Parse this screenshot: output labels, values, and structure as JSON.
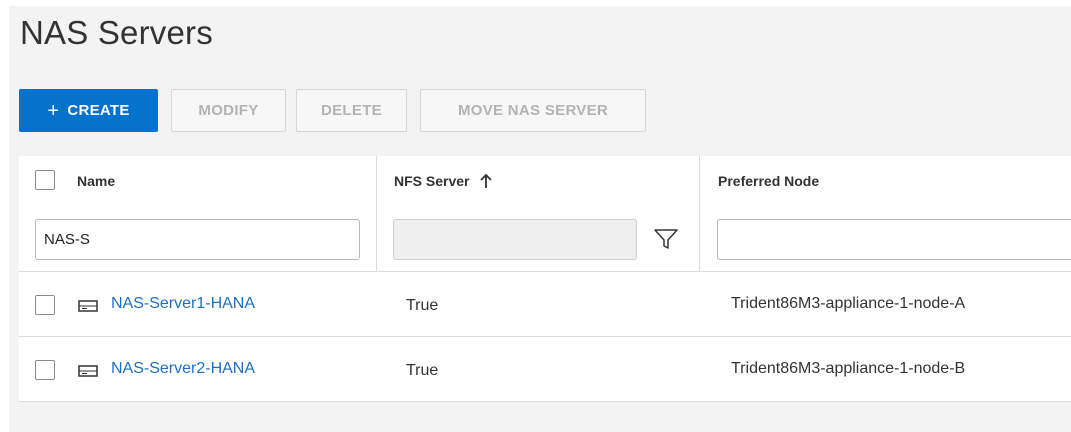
{
  "page": {
    "title": "NAS Servers"
  },
  "toolbar": {
    "create_label": "CREATE",
    "create_icon": "plus-icon",
    "modify_label": "MODIFY",
    "delete_label": "DELETE",
    "move_label": "MOVE NAS SERVER",
    "accent_color": "#0672cb"
  },
  "table": {
    "columns": [
      {
        "label": "Name"
      },
      {
        "label": "NFS Server",
        "sort": "ascending",
        "sort_icon": "arrow-up-icon"
      },
      {
        "label": "Preferred Node"
      }
    ],
    "filters": {
      "name_value": "NAS-S",
      "nfs_value": "",
      "node_value": "",
      "filter_icon": "funnel-icon"
    },
    "rows": [
      {
        "name": "NAS-Server1-HANA",
        "nfs_server": "True",
        "preferred_node": "Trident86M3-appliance-1-node-A",
        "icon": "server-icon"
      },
      {
        "name": "NAS-Server2-HANA",
        "nfs_server": "True",
        "preferred_node": "Trident86M3-appliance-1-node-B",
        "icon": "server-icon"
      }
    ]
  }
}
